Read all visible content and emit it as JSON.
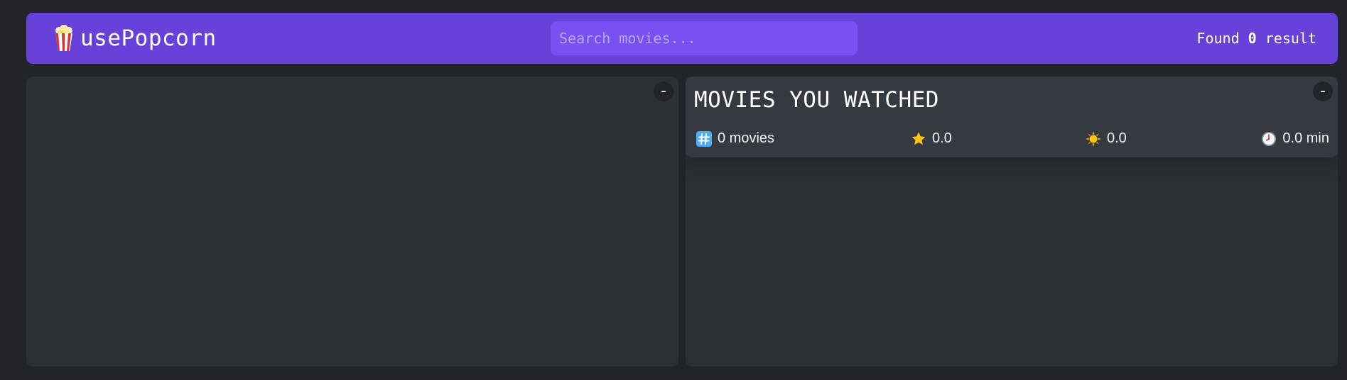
{
  "navbar": {
    "logo_text": "usePopcorn",
    "logo_icon": "popcorn-icon",
    "search_placeholder": "Search movies...",
    "search_value": "",
    "results_prefix": "Found ",
    "results_count": "0",
    "results_suffix": " result"
  },
  "list_box": {
    "toggle_label": "–"
  },
  "watched_box": {
    "toggle_label": "–",
    "title": "MOVIES YOU WATCHED",
    "stats": {
      "movies": "0 movies",
      "imdb_rating": "0.0",
      "user_rating": "0.0",
      "runtime": "0.0 min"
    },
    "icons": {
      "movies": "hash-icon",
      "imdb_rating": "star-icon",
      "user_rating": "sun-icon",
      "runtime": "clock-icon"
    }
  },
  "colors": {
    "background": "#212529",
    "navbar": "#6741d9",
    "search": "#7950f2",
    "box": "#2b3035",
    "summary": "#343a40"
  }
}
